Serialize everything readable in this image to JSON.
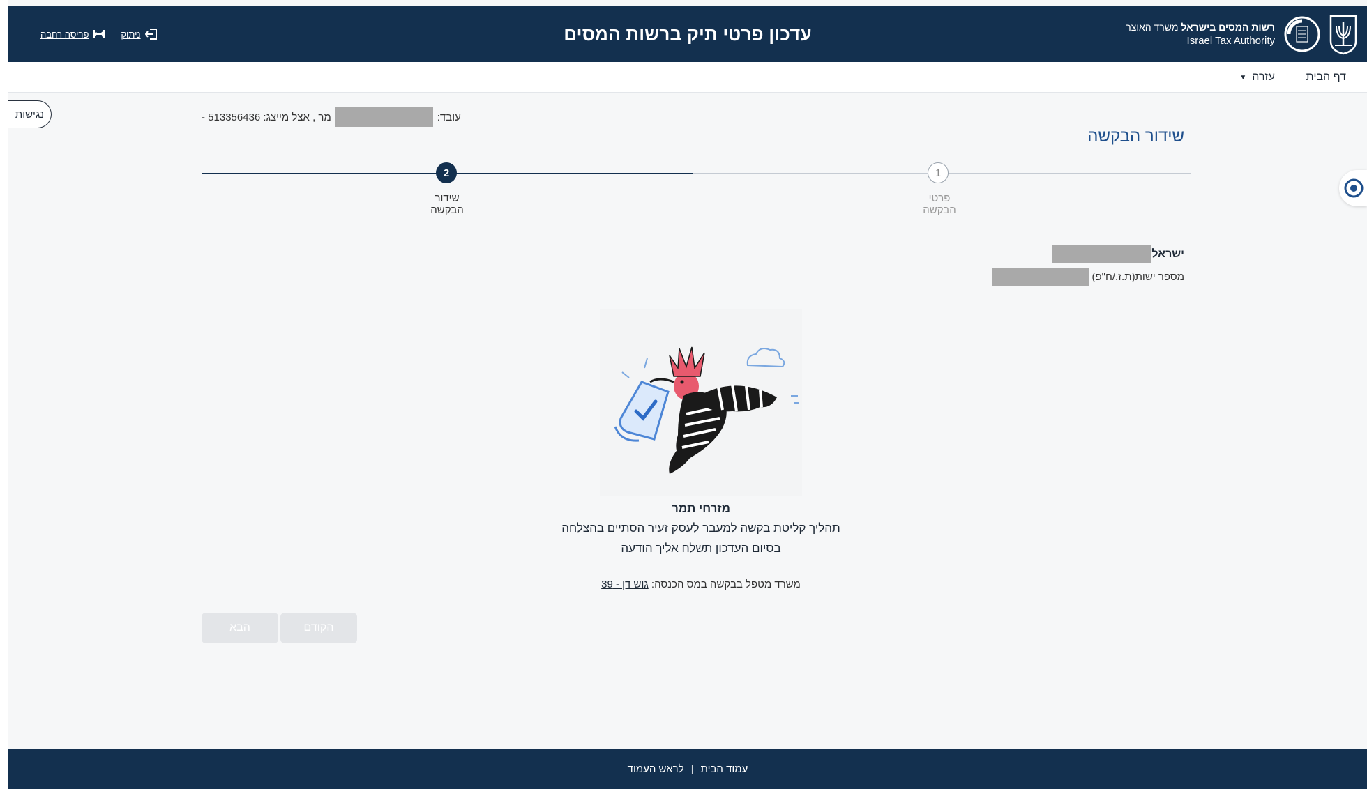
{
  "header": {
    "title": "עדכון פרטי תיק ברשות המסים",
    "brand_line1_bold": "רשות המסים בישראל",
    "brand_line1_rest": "משרד האוצר",
    "brand_line2": "Israel Tax Authority",
    "logout_label": "ניתוק",
    "wide_layout_label": "פריסה רחבה"
  },
  "nav": {
    "home": "דף הבית",
    "help": "עזרה"
  },
  "accessibility_label": "נגישות",
  "client": {
    "label": "עובד:",
    "mid": "מר , אצל מייצג: 513356436 -"
  },
  "page_title": "שידור הבקשה",
  "steps": [
    {
      "number": "1",
      "label": "פרטי הבקשה"
    },
    {
      "number": "2",
      "label": "שידור הבקשה"
    }
  ],
  "person": {
    "name_prefix": "ישראל",
    "id_label": "מספר ישות(ת.ז./ח\"פ)"
  },
  "messages": {
    "name": "מזרחי תמר",
    "line1": "תהליך קליטת בקשה למעבר לעסק זעיר הסתיים בהצלחה",
    "line2": "בסיום העדכון תשלח אליך הודעה",
    "office_label": "משרד מטפל בבקשה במס הכנסה:",
    "office_value": "גוש דן - 39"
  },
  "buttons": {
    "next": "הבא",
    "prev": "הקודם"
  },
  "footer": {
    "home": "עמוד הבית",
    "top": "לראש העמוד"
  },
  "colors": {
    "header_bg": "#13304f",
    "title_blue": "#1e4f8c",
    "hoopoe_crest": "#e85a6e"
  }
}
